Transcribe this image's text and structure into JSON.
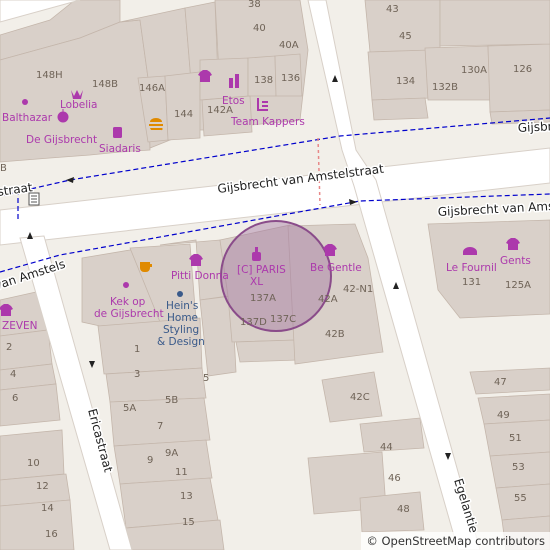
{
  "map": {
    "accent_colors": {
      "poi": "#ac39ac",
      "route": "#0000cc",
      "building": "#d9d0c9",
      "road": "#ffffff",
      "highlight_circle": "#a070a0"
    },
    "streets": {
      "main": "Gijsbrecht van Amstelstraat",
      "main_left": "straat",
      "main_left_lower": "van Amstels",
      "right_top": "Gijsbr",
      "ericastraat": "Ericastraat",
      "egelantierstraat": "Egelantie"
    },
    "pois": {
      "balthazar": "Balthazar",
      "lobelia": "Lobelia",
      "de_gijsbrecht_top": "De Gijsbrecht",
      "siadaris": "Siadaris",
      "etos": "Etos",
      "team_kappers": "Team Kappers",
      "kek_line1": "Kek op",
      "kek_line2": "de Gijsbrecht",
      "pitti_donna": "Pitti Donna",
      "heins_line1": "Hein's",
      "heins_line2": "Home",
      "heins_line3": "Styling",
      "heins_line4": "& Design",
      "cj_paris_line1": "[C] PARIS",
      "cj_paris_line2": "XL",
      "be_gentle": "Be Gentle",
      "le_fournil": "Le Fournil",
      "gents": "Gents",
      "zeven": "ZEVEN"
    },
    "house_numbers": {
      "n38": "38",
      "n40": "40",
      "n40a": "40A",
      "n43": "43",
      "n45": "45",
      "n148h": "148H",
      "n148b": "148B",
      "n146a": "146A",
      "n144": "144",
      "n142a": "142A",
      "n138": "138",
      "n136": "136",
      "n134": "134",
      "n132b": "132B",
      "n130a": "130A",
      "n126": "126",
      "n1": "1",
      "n3": "3",
      "n2": "2",
      "n4": "4",
      "n6": "6",
      "n5": "5",
      "n5a": "5A",
      "n5b": "5B",
      "n7": "7",
      "n9": "9",
      "n9a": "9A",
      "n11": "11",
      "n13": "13",
      "n15": "15",
      "n10": "10",
      "n12": "12",
      "n14": "14",
      "n16": "16",
      "n137a": "137A",
      "n137d": "137D",
      "n137c": "137C",
      "n42a": "42A",
      "n42n1": "42-N1",
      "n42b": "42B",
      "n42c": "42C",
      "n44": "44",
      "n46": "46",
      "n48": "48",
      "n131": "131",
      "n125a": "125A",
      "n47": "47",
      "n49": "49",
      "n51": "51",
      "n53": "53",
      "n55": "55",
      "nB": "B"
    }
  },
  "attribution": {
    "copyright": "©",
    "link_text": "OpenStreetMap contributors"
  }
}
